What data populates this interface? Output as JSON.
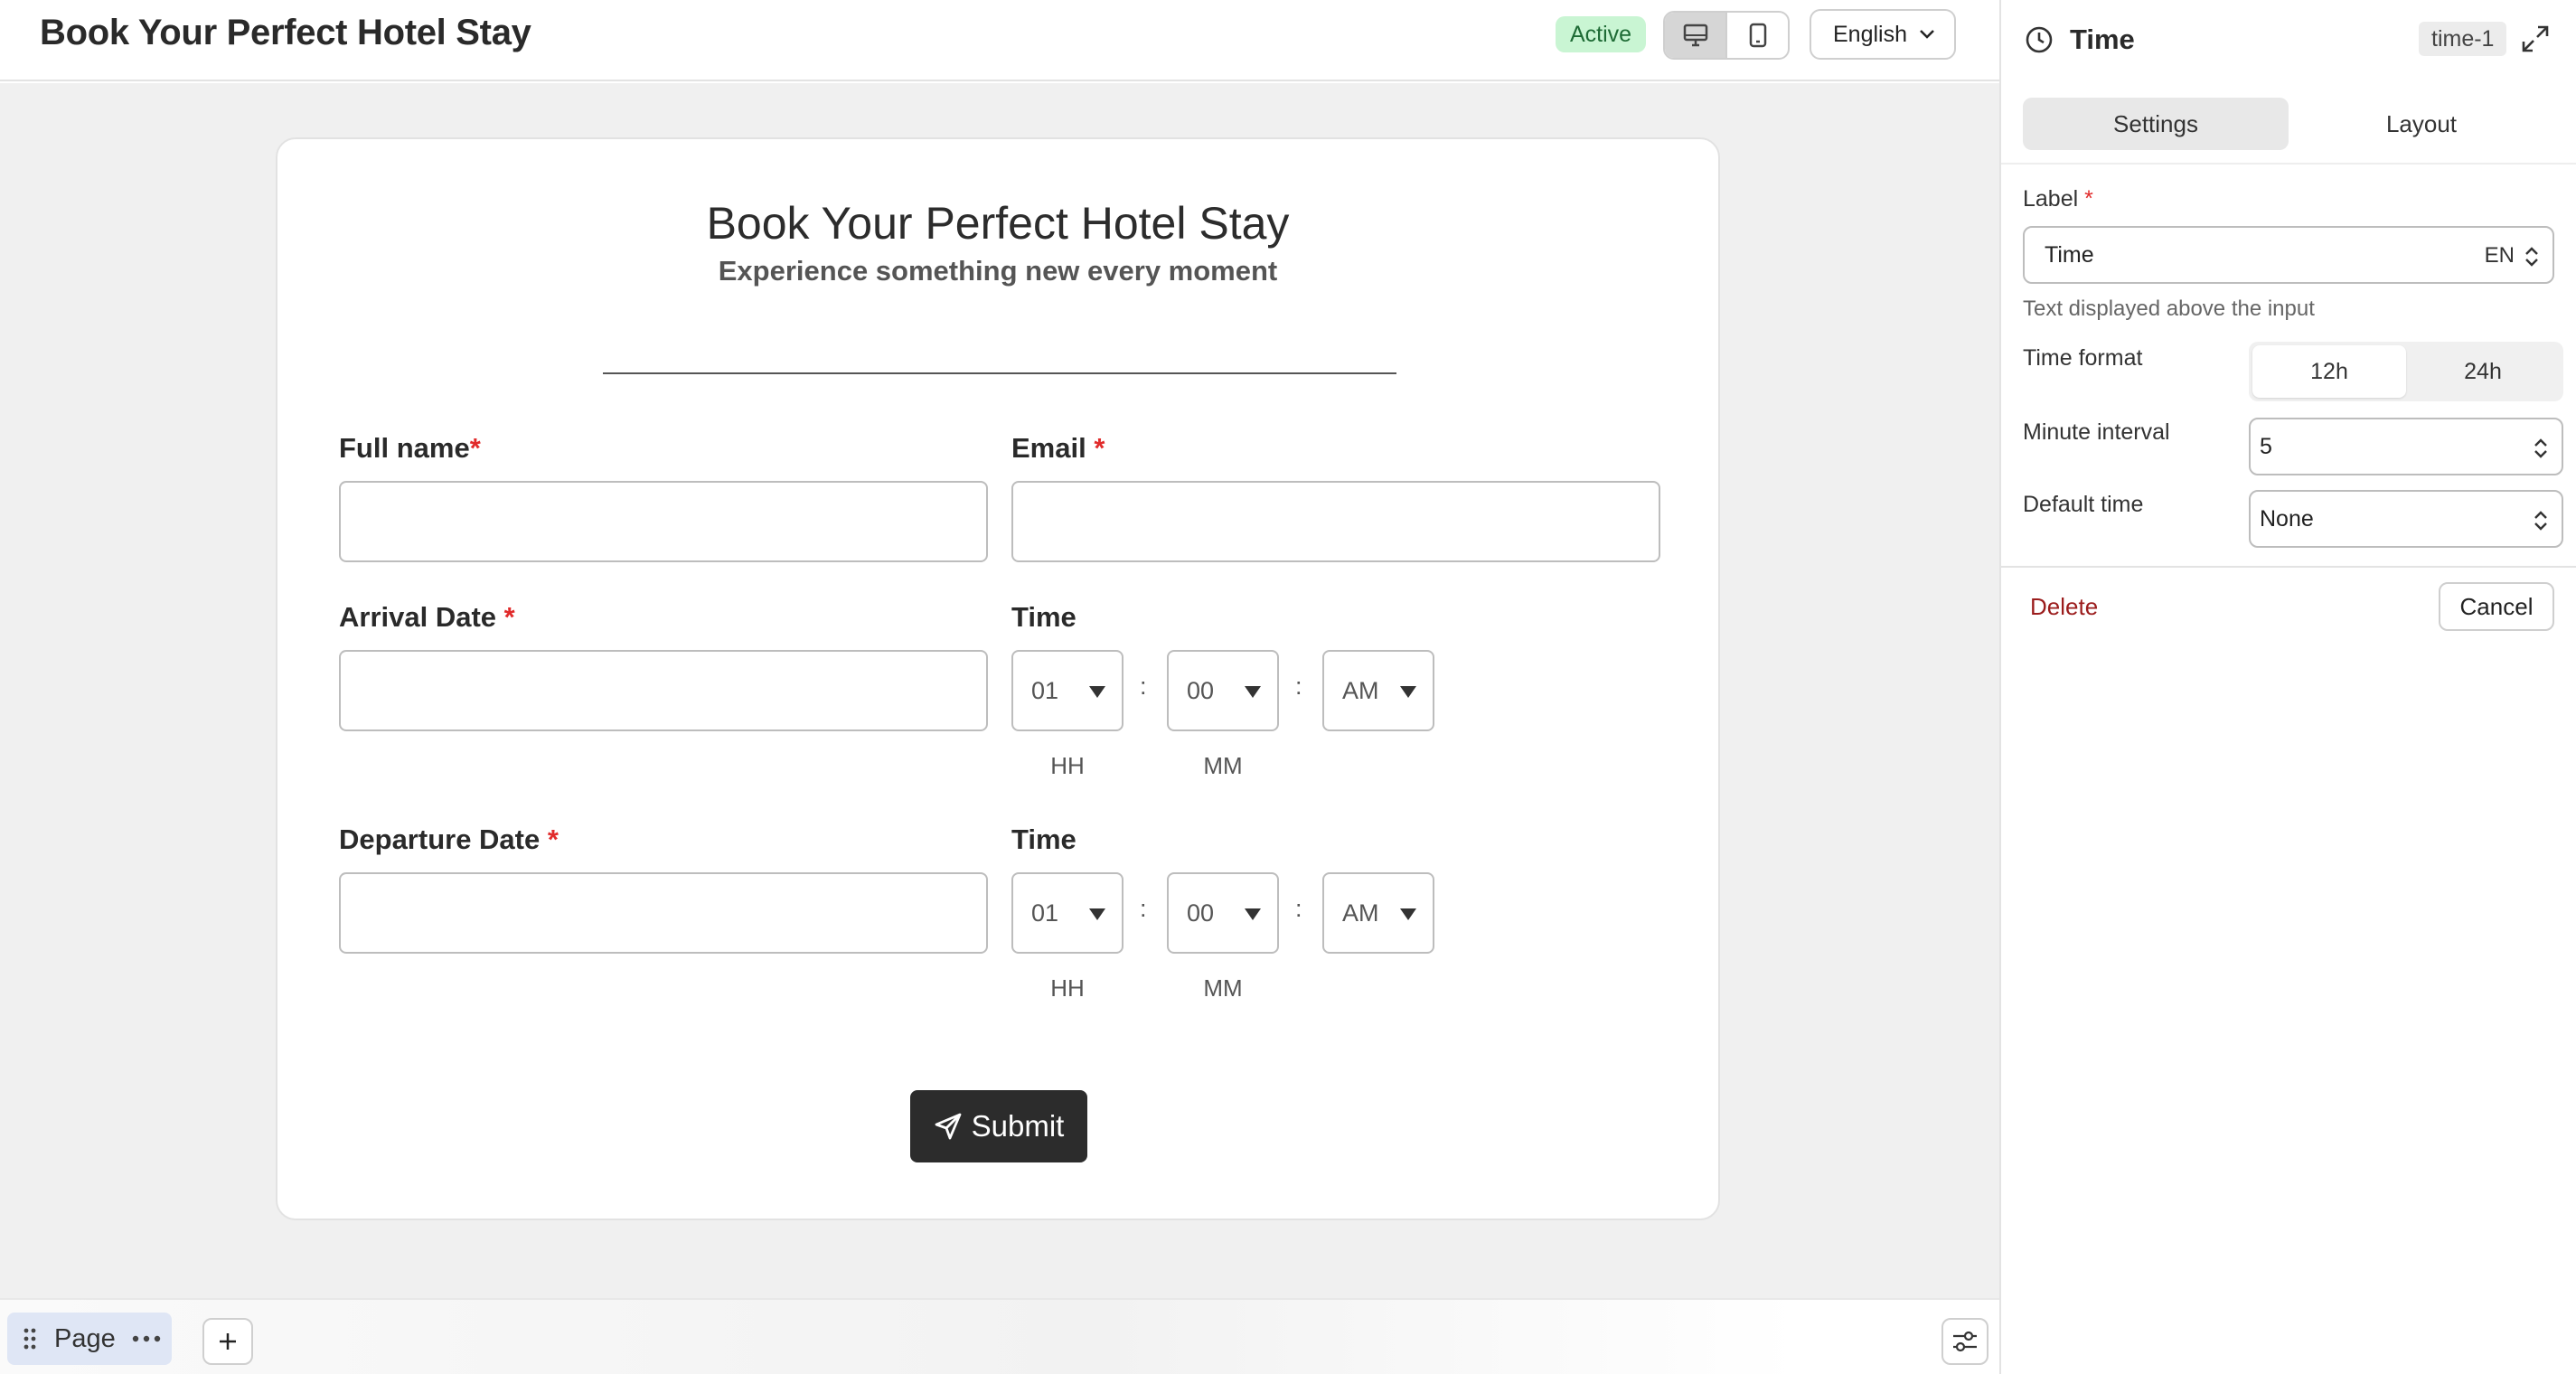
{
  "header": {
    "title": "Book Your Perfect Hotel Stay",
    "status": "Active",
    "language": "English"
  },
  "form": {
    "title": "Book Your Perfect Hotel Stay",
    "subtitle": "Experience something new every moment",
    "fields": {
      "full_name": {
        "label": "Full name",
        "required_mark": "*"
      },
      "email": {
        "label": "Email",
        "required_mark": "*"
      },
      "arrival_date": {
        "label": "Arrival Date",
        "required_mark": "*"
      },
      "arrival_time": {
        "label": "Time",
        "hour": "01",
        "minute": "00",
        "period": "AM",
        "separator": ":",
        "hour_caption": "HH",
        "minute_caption": "MM"
      },
      "departure_date": {
        "label": "Departure Date",
        "required_mark": "*"
      },
      "departure_time": {
        "label": "Time",
        "hour": "01",
        "minute": "00",
        "period": "AM",
        "separator": ":",
        "hour_caption": "HH",
        "minute_caption": "MM"
      }
    },
    "submit_label": "Submit"
  },
  "bottom_bar": {
    "page_label": "Page"
  },
  "panel": {
    "title": "Time",
    "element_id": "time-1",
    "tabs": [
      {
        "label": "Settings",
        "active": true
      },
      {
        "label": "Layout",
        "active": false
      }
    ],
    "label_field": {
      "label": "Label",
      "required_mark": "*",
      "value": "Time",
      "language": "EN",
      "help": "Text displayed above the input"
    },
    "time_format": {
      "label": "Time format",
      "options": [
        "12h",
        "24h"
      ],
      "selected": "12h"
    },
    "minute_interval": {
      "label": "Minute interval",
      "value": "5"
    },
    "default_time": {
      "label": "Default time",
      "value": "None"
    },
    "delete_label": "Delete",
    "cancel_label": "Cancel"
  },
  "colors": {
    "accent_dark": "#2c2c2c",
    "status_bg": "#c9f5d3",
    "status_text": "#1e6b35",
    "required": "#e12b2b",
    "delete": "#9b1c1c",
    "canvas_bg": "#f0f0f0"
  },
  "icons": {
    "desktop": "desktop-icon",
    "mobile": "mobile-icon",
    "chevron": "chevron-down-icon",
    "clock": "clock-icon",
    "expand": "expand-icon",
    "send": "send-icon",
    "drag": "drag-handle-icon",
    "more": "more-icon",
    "plus": "plus-icon",
    "sliders": "sliders-icon",
    "stepper": "stepper-icon"
  }
}
